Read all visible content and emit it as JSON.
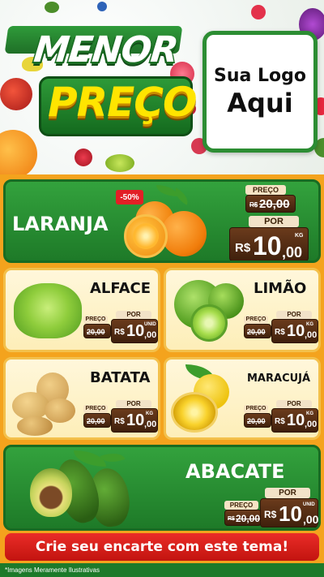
{
  "header": {
    "title_line1": "MENOR",
    "title_line2": "PREÇO",
    "logo_line1": "Sua Logo",
    "logo_line2": "Aqui"
  },
  "featured": {
    "name": "LARANJA",
    "discount": "-50%",
    "old_label": "PREÇO",
    "old_currency": "R$",
    "old_price": "20,00",
    "new_label": "POR",
    "currency": "R$",
    "price_int": "10",
    "price_dec": ",00",
    "unit": "KG"
  },
  "products": [
    {
      "name": "ALFACE",
      "old_label": "PREÇO",
      "old_currency": "R$",
      "old_price": "20,00",
      "new_label": "POR",
      "currency": "R$",
      "price_int": "10",
      "price_dec": ",00",
      "unit": "UNID"
    },
    {
      "name": "LIMÃO",
      "old_label": "PREÇO",
      "old_currency": "R$",
      "old_price": "20,00",
      "new_label": "POR",
      "currency": "R$",
      "price_int": "10",
      "price_dec": ",00",
      "unit": "KG"
    },
    {
      "name": "BATATA",
      "old_label": "PREÇO",
      "old_currency": "R$",
      "old_price": "20,00",
      "new_label": "POR",
      "currency": "R$",
      "price_int": "10",
      "price_dec": ",00",
      "unit": "KG"
    },
    {
      "name": "MARACUJÁ",
      "old_label": "PREÇO",
      "old_currency": "R$",
      "old_price": "20,00",
      "new_label": "POR",
      "currency": "R$",
      "price_int": "10",
      "price_dec": ",00",
      "unit": "KG"
    }
  ],
  "bottom_product": {
    "name": "ABACATE",
    "old_label": "PREÇO",
    "old_currency": "R$",
    "old_price": "20,00",
    "new_label": "POR",
    "currency": "R$",
    "price_int": "10",
    "price_dec": ",00",
    "unit": "UNID"
  },
  "cta": {
    "label": "Crie seu encarte com este tema!"
  },
  "footer": {
    "note": "*Imagens Meramente Ilustrativas"
  },
  "colors": {
    "background_orange": "#f4a31d",
    "card_green": "#2a8e34",
    "card_cream": "#fff7db",
    "title_yellow": "#ffe500",
    "cta_red": "#e21f26",
    "price_wood": "#5a3018"
  },
  "icons": [
    "orange-fruit-image",
    "lettuce-image",
    "lime-image",
    "potato-image",
    "passion-fruit-image",
    "avocado-image",
    "shopping-cart-graphic"
  ]
}
